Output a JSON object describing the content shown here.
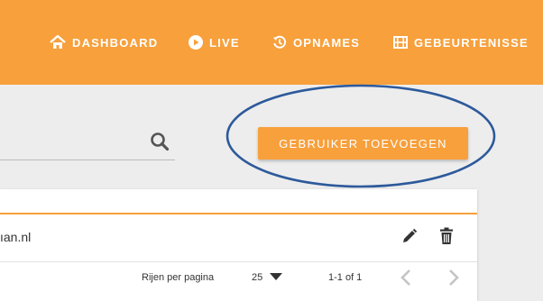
{
  "nav": {
    "items": [
      {
        "label": "DASHBOARD",
        "icon": "home-icon"
      },
      {
        "label": "LIVE",
        "icon": "play-circle-icon"
      },
      {
        "label": "OPNAMES",
        "icon": "history-icon"
      },
      {
        "label": "GEBEURTENISSE",
        "icon": "film-icon"
      }
    ]
  },
  "toolbar": {
    "add_user_label": "GEBRUIKER TOEVOEGEN"
  },
  "table": {
    "rows": [
      {
        "email": "ıan.nl"
      }
    ]
  },
  "pagination": {
    "rows_label": "Rijen per pagina",
    "rows_per_page": "25",
    "range": "1-1 of 1"
  },
  "colors": {
    "accent": "#f7a03c",
    "highlight": "#2d5a9b"
  }
}
